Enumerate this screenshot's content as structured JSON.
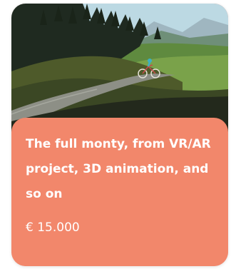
{
  "card": {
    "title": "The full monty, from VR/AR project, 3D animation, and so on",
    "price": "€ 15.000",
    "image_icon": "mountain-cyclist-illustration",
    "colors": {
      "card_bg": "#f2876b",
      "text": "#ffffff"
    }
  }
}
